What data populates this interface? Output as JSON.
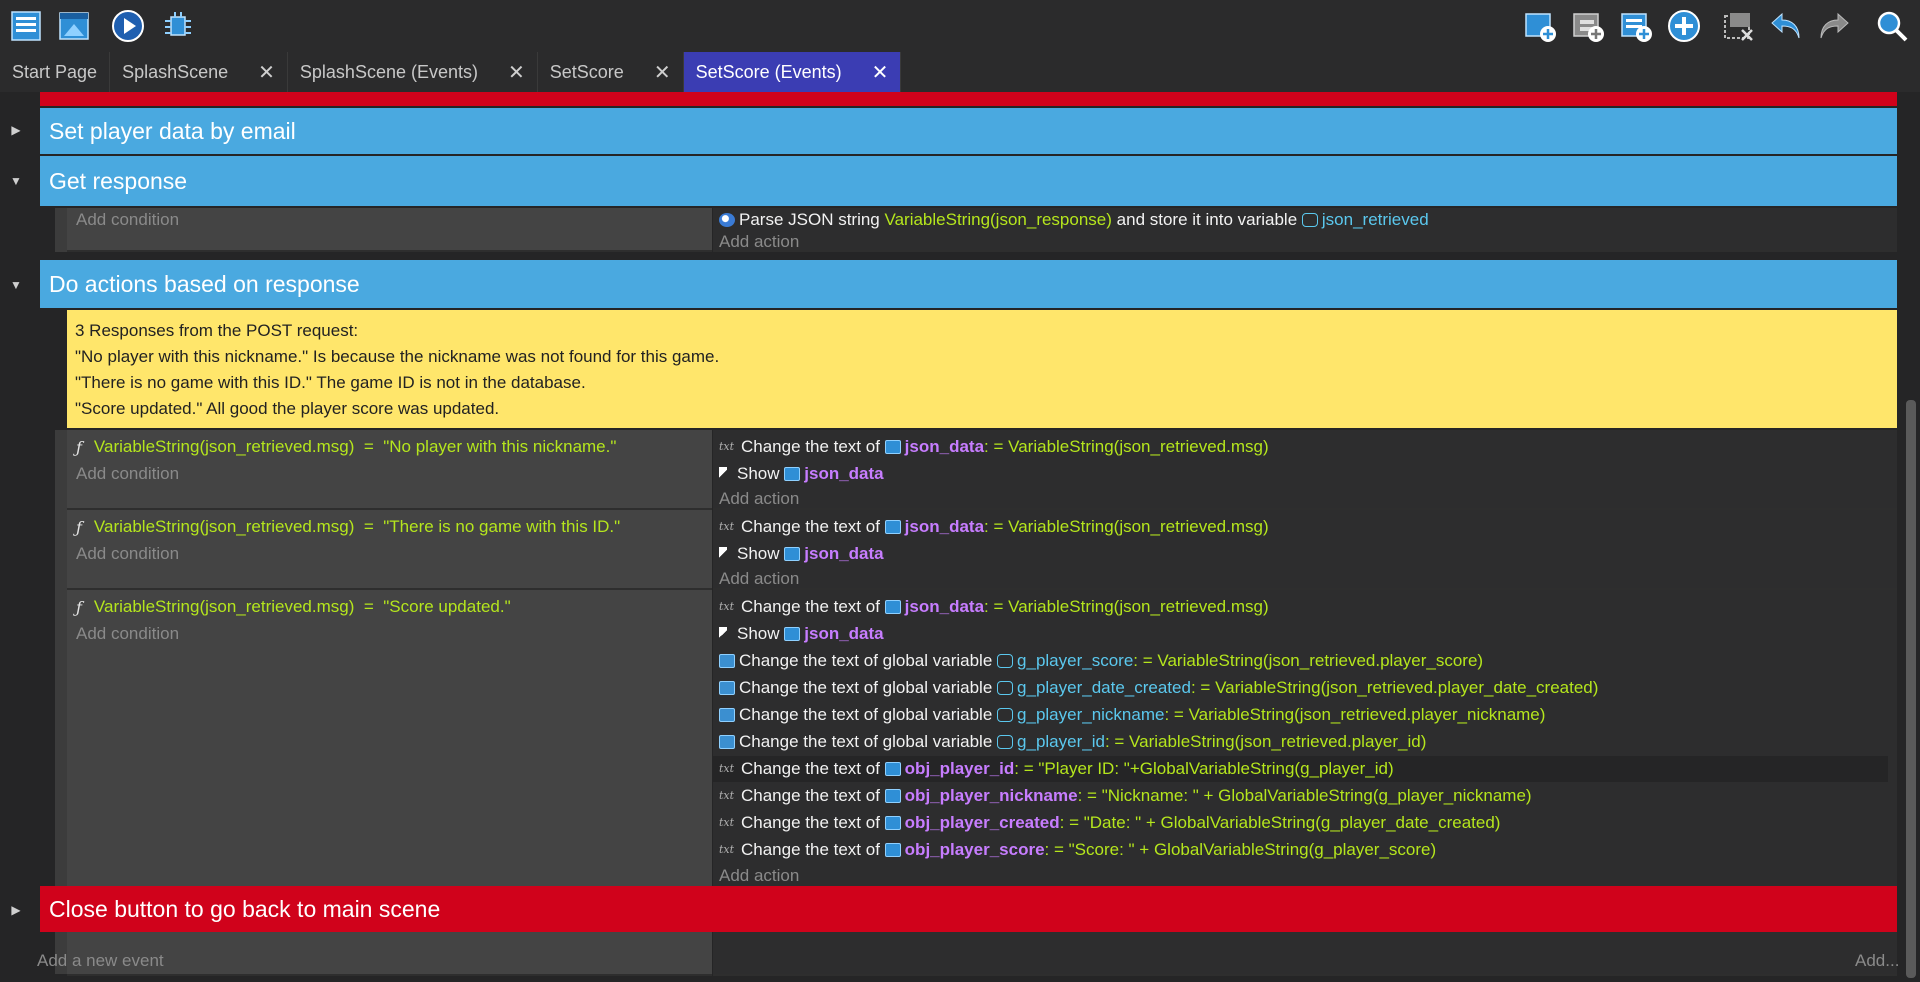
{
  "toolbar": {
    "left": [
      {
        "icon": "events-list-icon",
        "label": "Event sheet"
      },
      {
        "icon": "scene-icon",
        "label": "Scene"
      },
      {
        "icon": "play-icon",
        "label": "Preview"
      },
      {
        "icon": "debug-icon",
        "label": "Debugger"
      }
    ],
    "right": [
      {
        "icon": "add-event-icon"
      },
      {
        "icon": "add-subevent-icon"
      },
      {
        "icon": "add-comment-icon"
      },
      {
        "icon": "add-other-icon"
      },
      {
        "icon": "delete-icon"
      },
      {
        "icon": "undo-icon"
      },
      {
        "icon": "redo-icon"
      },
      {
        "icon": "search-icon"
      }
    ]
  },
  "tabs": [
    {
      "label": "Start Page",
      "closable": false,
      "active": false
    },
    {
      "label": "SplashScene",
      "closable": true,
      "active": false
    },
    {
      "label": "SplashScene (Events)",
      "closable": true,
      "active": false
    },
    {
      "label": "SetScore",
      "closable": true,
      "active": false
    },
    {
      "label": "SetScore (Events)",
      "closable": true,
      "active": true
    }
  ],
  "tab_close_glyph": "✕",
  "groups": {
    "set_player": "Set player data by email",
    "get_response": "Get response",
    "do_actions": "Do actions based on response",
    "close_button": "Close button to go back to main scene"
  },
  "common": {
    "add_condition": "Add condition",
    "add_action": "Add action",
    "add_new_event": "Add a new event",
    "add_more": "Add...",
    "change_text_of": "Change the text of",
    "change_text_global": "Change the text of global variable",
    "show": "Show",
    "eq": "=",
    "colon_eq": ": ="
  },
  "get_response": {
    "parse_prefix": "Parse JSON string",
    "parse_expr": "VariableString(json_response)",
    "parse_mid": "and store it into variable",
    "parse_var": "json_retrieved"
  },
  "comment": {
    "lines": [
      "3 Responses from the POST request:",
      "\"No player with this nickname.\" Is because the nickname was not found for this game.",
      "\"There is no game with this ID.\" The game ID is not in the database.",
      "\"Score updated.\" All good the player score was updated."
    ]
  },
  "events": [
    {
      "condition_left": "VariableString(json_retrieved.msg)",
      "condition_right": "\"No player with this nickname.\"",
      "target": "json_data",
      "value": "VariableString(json_retrieved.msg)"
    },
    {
      "condition_left": "VariableString(json_retrieved.msg)",
      "condition_right": "\"There is no game with this ID.\"",
      "target": "json_data",
      "value": "VariableString(json_retrieved.msg)"
    },
    {
      "condition_left": "VariableString(json_retrieved.msg)",
      "condition_right": "\"Score updated.\"",
      "target": "json_data",
      "value": "VariableString(json_retrieved.msg)",
      "globals": [
        {
          "var": "g_player_score",
          "value": "VariableString(json_retrieved.player_score)"
        },
        {
          "var": "g_player_date_created",
          "value": "VariableString(json_retrieved.player_date_created)"
        },
        {
          "var": "g_player_nickname",
          "value": "VariableString(json_retrieved.player_nickname)"
        },
        {
          "var": "g_player_id",
          "value": "VariableString(json_retrieved.player_id)"
        }
      ],
      "objects": [
        {
          "obj": "obj_player_id",
          "value": "\"Player ID: \"+GlobalVariableString(g_player_id)"
        },
        {
          "obj": "obj_player_nickname",
          "value": "\"Nickname: \" + GlobalVariableString(g_player_nickname)"
        },
        {
          "obj": "obj_player_created",
          "value": "\"Date: \" + GlobalVariableString(g_player_date_created)"
        },
        {
          "obj": "obj_player_score",
          "value": "\"Score: \" + GlobalVariableString(g_player_score)"
        }
      ]
    }
  ],
  "colors": {
    "group_blue": "#4aa9e0",
    "group_red": "#d0021b",
    "comment_yellow": "#ffe66b",
    "expression_green": "#b5e61d",
    "variable_cyan": "#5bc8ee",
    "object_purple": "#c77dff",
    "active_tab": "#3b3db3"
  }
}
